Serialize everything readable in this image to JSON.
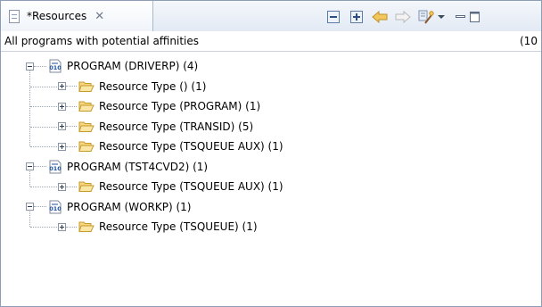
{
  "tab": {
    "title": "*Resources",
    "close_glyph": "✕",
    "icon": "document-icon"
  },
  "toolbar": {
    "buttons": [
      {
        "name": "collapse-all-icon"
      },
      {
        "name": "expand-all-icon"
      },
      {
        "name": "back-arrow-icon"
      },
      {
        "name": "forward-arrow-icon"
      },
      {
        "name": "filter-wand-icon"
      },
      {
        "name": "view-menu-chevron-icon"
      },
      {
        "name": "minimize-icon"
      },
      {
        "name": "maximize-icon"
      }
    ]
  },
  "header": {
    "text": "All programs with potential affinities",
    "count": "(10"
  },
  "tree": {
    "programs": [
      {
        "label": "PROGRAM (DRIVERP)  (4)",
        "children": [
          "Resource Type ()  (1)",
          "Resource Type (PROGRAM)  (1)",
          "Resource Type (TRANSID)  (5)",
          "Resource Type (TSQUEUE AUX)  (1)"
        ]
      },
      {
        "label": "PROGRAM (TST4CVD2)  (1)",
        "children": [
          "Resource Type (TSQUEUE AUX)  (1)"
        ]
      },
      {
        "label": "PROGRAM (WORKP)  (1)",
        "children": [
          "Resource Type (TSQUEUE)  (1)"
        ]
      }
    ]
  },
  "colors": {
    "folder_fill": "#f6d77e",
    "folder_stroke": "#c79a2e",
    "arrow_fill": "#f2c85c",
    "program_icon_blue": "#1c4fa3"
  }
}
